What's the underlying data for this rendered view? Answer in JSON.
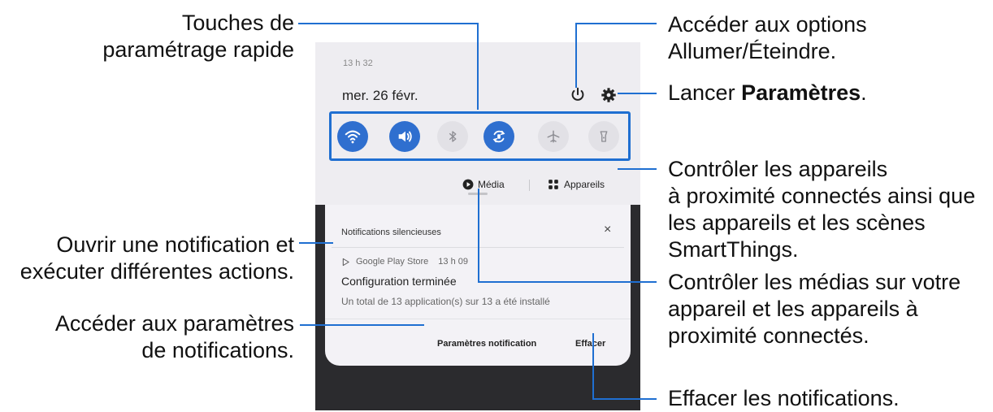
{
  "phone": {
    "time": "13 h 32",
    "date": "mer. 26 févr.",
    "media_label": "Média",
    "devices_label": "Appareils",
    "quick_settings": [
      {
        "icon": "wifi-icon",
        "state": "on"
      },
      {
        "icon": "sound-icon",
        "state": "on"
      },
      {
        "icon": "bluetooth-icon",
        "state": "off"
      },
      {
        "icon": "auto-rotate-icon",
        "state": "on"
      },
      {
        "icon": "airplane-icon",
        "state": "off"
      },
      {
        "icon": "flashlight-icon",
        "state": "off"
      }
    ],
    "notifications": {
      "header": "Notifications silencieuses",
      "close": "×",
      "app": "Google Play Store",
      "app_time": "13 h 09",
      "title": "Configuration terminée",
      "body": "Un total de 13 application(s) sur 13 a été installé",
      "settings_button": "Paramètres notification",
      "clear_button": "Effacer"
    }
  },
  "callouts": {
    "quick_keys": [
      "Touches de",
      "paramétrage rapide"
    ],
    "open_notification": [
      "Ouvrir une notification et",
      "exécuter différentes actions."
    ],
    "notification_settings": [
      "Accéder aux paramètres",
      "de notifications."
    ],
    "power_options": [
      "Accéder aux options",
      "Allumer/Éteindre."
    ],
    "settings_prefix": "Lancer ",
    "settings_bold": "Paramètres",
    "settings_suffix": ".",
    "devices": [
      "Contrôler les appareils",
      "à proximité connectés ainsi que",
      "les appareils et les scènes",
      "SmartThings."
    ],
    "media": [
      "Contrôler les médias sur votre",
      "appareil et les appareils à",
      "proximité connectés."
    ],
    "clear": [
      "Effacer les notifications."
    ]
  },
  "colors": {
    "leader": "#1f6fd1",
    "accent_on": "#2f6fcf"
  }
}
